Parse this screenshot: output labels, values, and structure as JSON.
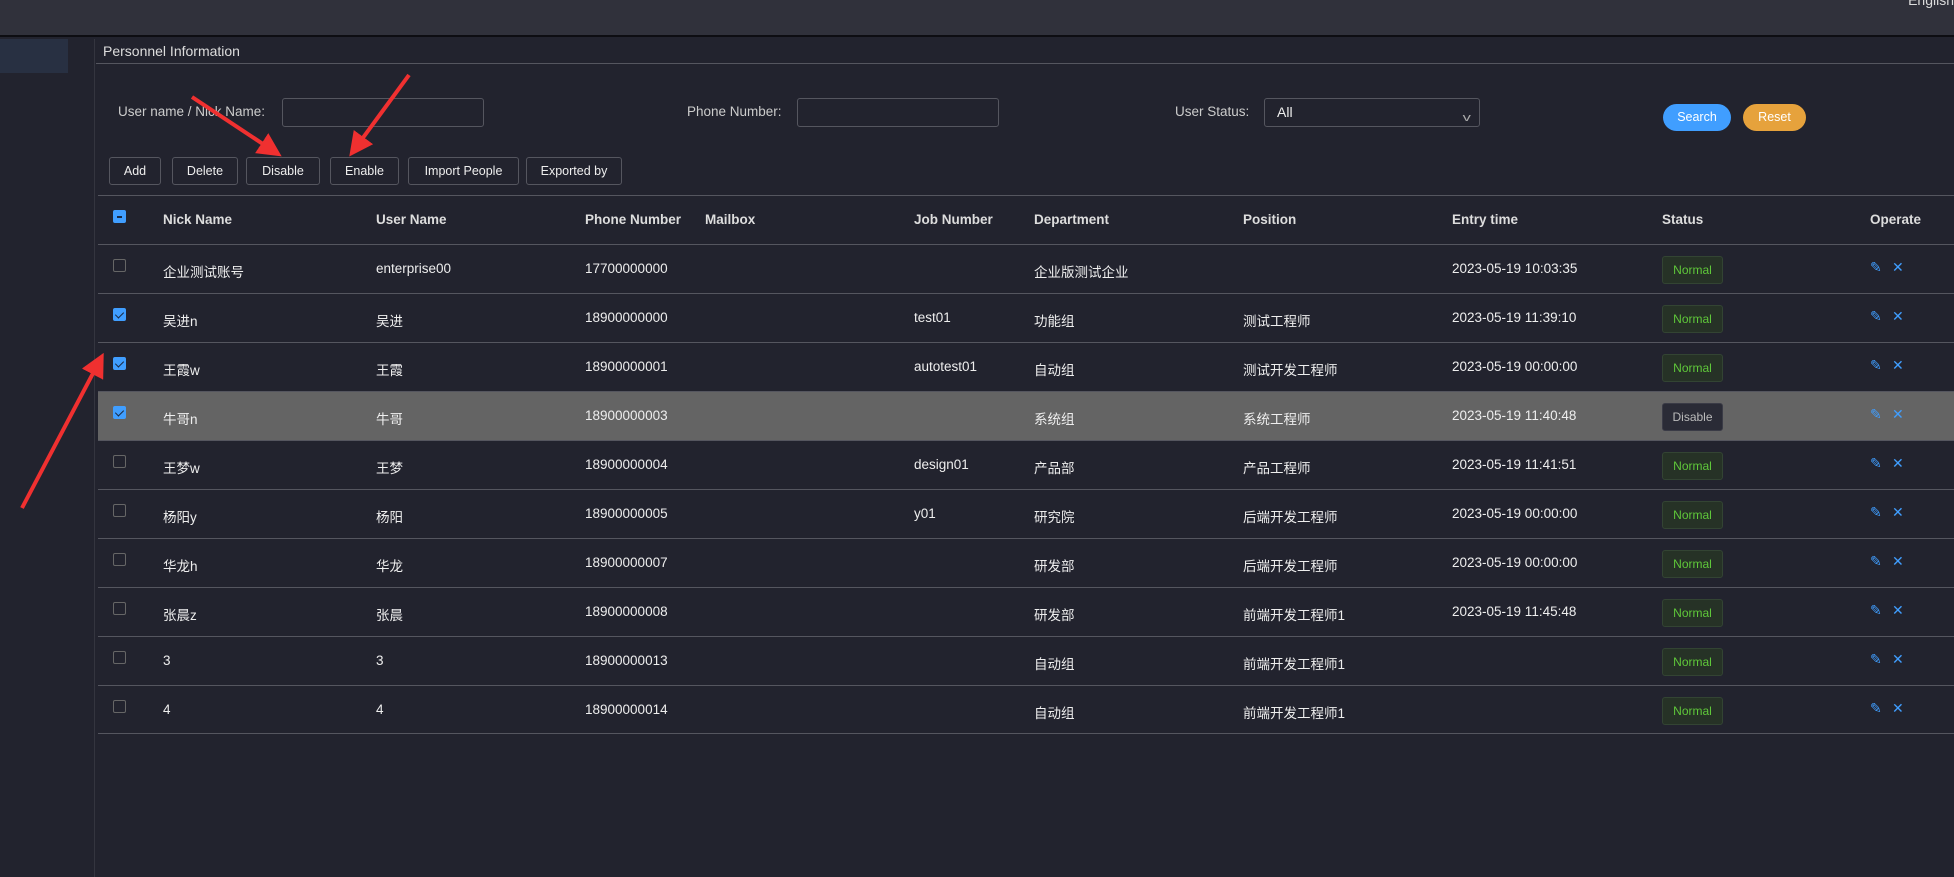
{
  "header": {
    "language_label": "English"
  },
  "page": {
    "title": "Personnel Information"
  },
  "filters": {
    "username_label": "User name / Nick Name:",
    "username_value": "",
    "phone_label": "Phone Number:",
    "phone_value": "",
    "status_label": "User Status:",
    "status_value": "All",
    "search_label": "Search",
    "reset_label": "Reset"
  },
  "toolbar": {
    "add": "Add",
    "delete": "Delete",
    "disable": "Disable",
    "enable": "Enable",
    "import": "Import People",
    "export": "Exported by"
  },
  "colors": {
    "accent": "#409eff",
    "reset": "#e6a23c",
    "normal_tag": "#5fc83a",
    "annotation_arrow": "#f03030"
  },
  "table": {
    "columns": [
      "Nick Name",
      "User Name",
      "Phone Number",
      "Mailbox",
      "Job Number",
      "Department",
      "Position",
      "Entry time",
      "Status",
      "Operate"
    ],
    "rows": [
      {
        "checked": false,
        "nick": "企业测试账号",
        "user": "enterprise00",
        "phone": "17700000000",
        "mail": "",
        "job": "",
        "dept": "企业版测试企业",
        "pos": "",
        "entry": "2023-05-19 10:03:35",
        "status": "Normal"
      },
      {
        "checked": true,
        "nick": "吴进n",
        "user": "吴进",
        "phone": "18900000000",
        "mail": "",
        "job": "test01",
        "dept": "功能组",
        "pos": "测试工程师",
        "entry": "2023-05-19 11:39:10",
        "status": "Normal"
      },
      {
        "checked": true,
        "nick": "王霞w",
        "user": "王霞",
        "phone": "18900000001",
        "mail": "",
        "job": "autotest01",
        "dept": "自动组",
        "pos": "测试开发工程师",
        "entry": "2023-05-19 00:00:00",
        "status": "Normal"
      },
      {
        "checked": true,
        "nick": "牛哥n",
        "user": "牛哥",
        "phone": "18900000003",
        "mail": "",
        "job": "",
        "dept": "系统组",
        "pos": "系统工程师",
        "entry": "2023-05-19 11:40:48",
        "status": "Disable"
      },
      {
        "checked": false,
        "nick": "王梦w",
        "user": "王梦",
        "phone": "18900000004",
        "mail": "",
        "job": "design01",
        "dept": "产品部",
        "pos": "产品工程师",
        "entry": "2023-05-19 11:41:51",
        "status": "Normal"
      },
      {
        "checked": false,
        "nick": "杨阳y",
        "user": "杨阳",
        "phone": "18900000005",
        "mail": "",
        "job": "y01",
        "dept": "研究院",
        "pos": "后端开发工程师",
        "entry": "2023-05-19 00:00:00",
        "status": "Normal"
      },
      {
        "checked": false,
        "nick": "华龙h",
        "user": "华龙",
        "phone": "18900000007",
        "mail": "",
        "job": "",
        "dept": "研发部",
        "pos": "后端开发工程师",
        "entry": "2023-05-19 00:00:00",
        "status": "Normal"
      },
      {
        "checked": false,
        "nick": "张晨z",
        "user": "张晨",
        "phone": "18900000008",
        "mail": "",
        "job": "",
        "dept": "研发部",
        "pos": "前端开发工程师1",
        "entry": "2023-05-19 11:45:48",
        "status": "Normal"
      },
      {
        "checked": false,
        "nick": "3",
        "user": "3",
        "phone": "18900000013",
        "mail": "",
        "job": "",
        "dept": "自动组",
        "pos": "前端开发工程师1",
        "entry": "",
        "status": "Normal"
      },
      {
        "checked": false,
        "nick": "4",
        "user": "4",
        "phone": "18900000014",
        "mail": "",
        "job": "",
        "dept": "自动组",
        "pos": "前端开发工程师1",
        "entry": "",
        "status": "Normal"
      }
    ]
  }
}
